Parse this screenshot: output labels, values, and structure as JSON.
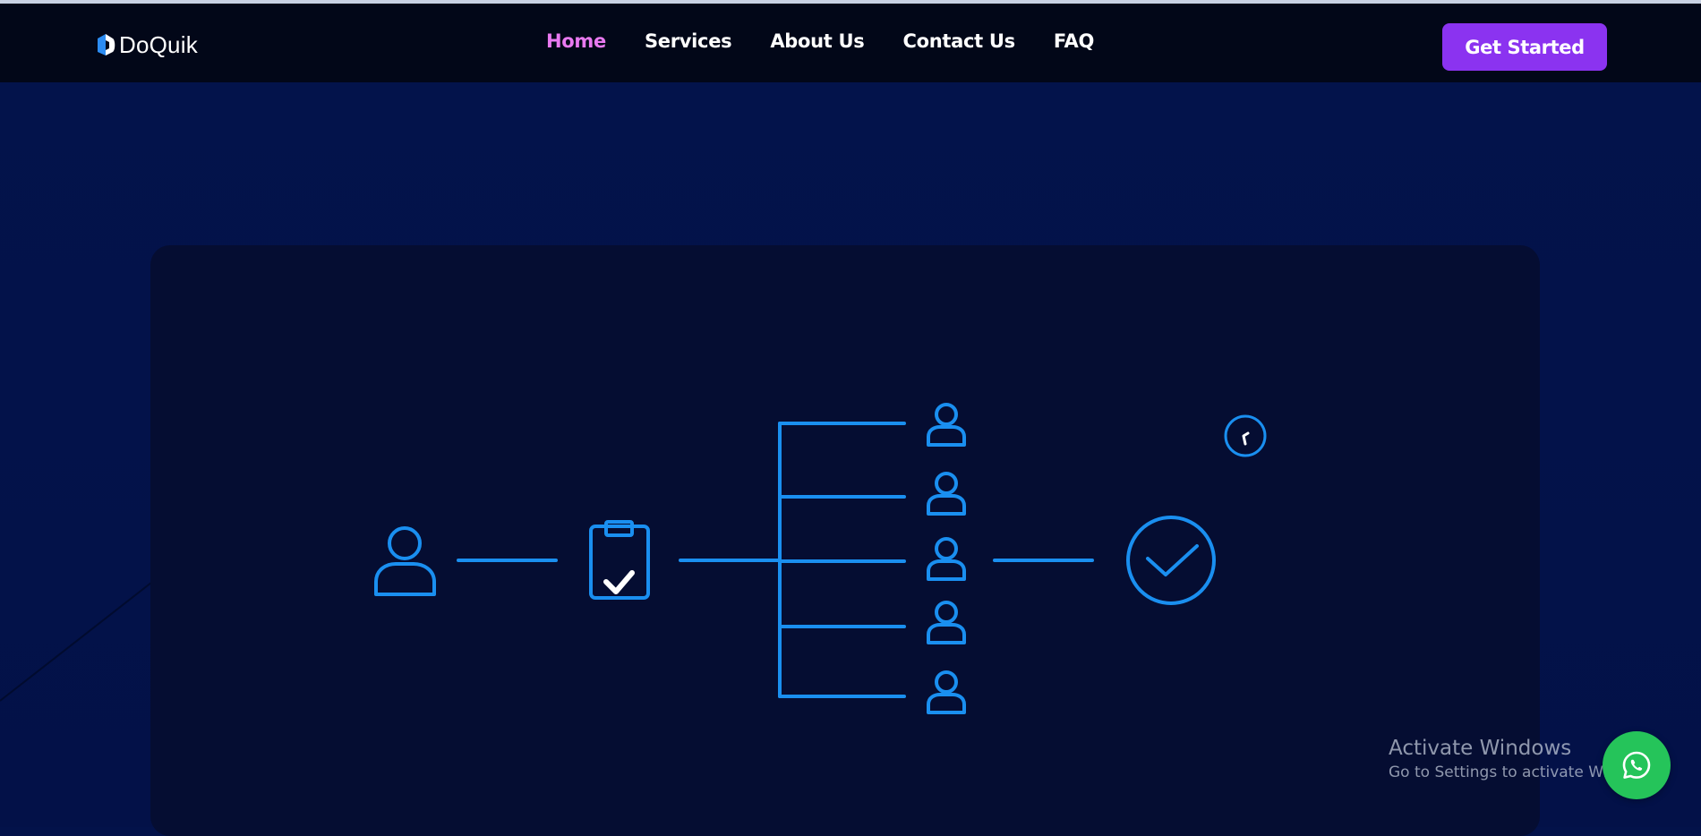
{
  "brand": {
    "name": "DoQuik",
    "logo_icon": "doquik-logo-icon"
  },
  "nav": {
    "items": [
      {
        "label": "Home",
        "active": true
      },
      {
        "label": "Services",
        "active": false
      },
      {
        "label": "About Us",
        "active": false
      },
      {
        "label": "Contact Us",
        "active": false
      },
      {
        "label": "FAQ",
        "active": false
      }
    ]
  },
  "cta": {
    "label": "Get Started"
  },
  "colors": {
    "nav_background": "#020718",
    "page_background": "#03124a",
    "card_background": "#050d32",
    "accent_active": "#e979f0",
    "button": "#8b33f0",
    "diagram_stroke": "#1a8ff0",
    "whatsapp": "#25c45a"
  },
  "workflow_diagram": {
    "icons": [
      "client-user-icon",
      "clipboard-check-icon",
      "team-member-icon",
      "team-member-icon",
      "team-member-icon",
      "team-member-icon",
      "team-member-icon",
      "completed-check-circle-icon",
      "clock-icon"
    ],
    "team_members_count": 5
  },
  "os_watermark": {
    "title": "Activate Windows",
    "subtitle": "Go to Settings to activate Windows."
  },
  "floating_button": {
    "icon": "whatsapp-icon"
  }
}
